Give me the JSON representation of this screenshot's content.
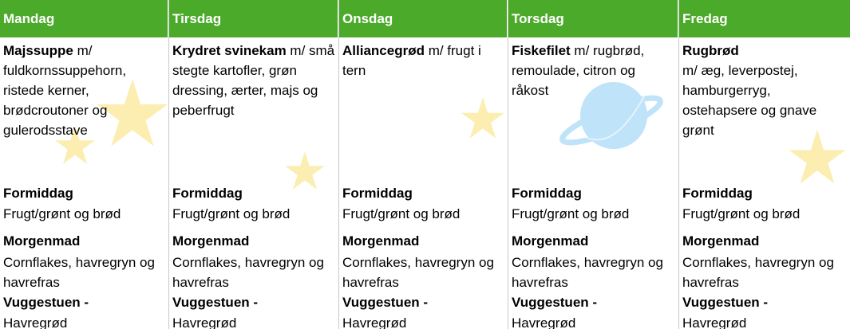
{
  "days": [
    {
      "name": "Mandag",
      "lunch_bold": "Majssuppe",
      "lunch_rest": " m/ fuldkornssuppehorn, ristede kerner, brødcroutoner og gulerodsstave",
      "morning_title": "Formiddag",
      "morning_text": "Frugt/grønt og brød",
      "breakfast_title": "Morgenmad",
      "breakfast_text": "Cornflakes, havregryn og havrefras",
      "nursery_title": "Vuggestuen -",
      "nursery_text": "Havregrød"
    },
    {
      "name": "Tirsdag",
      "lunch_bold": "Krydret svinekam",
      "lunch_rest": " m/ små stegte kartofler, grøn dressing, ærter, majs og peberfrugt",
      "morning_title": "Formiddag",
      "morning_text": "Frugt/grønt og brød",
      "breakfast_title": "Morgenmad",
      "breakfast_text": "Cornflakes, havregryn og havrefras",
      "nursery_title": "Vuggestuen -",
      "nursery_text": "Havregrød"
    },
    {
      "name": "Onsdag",
      "lunch_bold": "Alliancegrød",
      "lunch_rest": " m/ frugt i tern",
      "morning_title": "Formiddag",
      "morning_text": "Frugt/grønt og brød",
      "breakfast_title": "Morgenmad",
      "breakfast_text": "Cornflakes, havregryn og havrefras",
      "nursery_title": "Vuggestuen -",
      "nursery_text": "Havregrød"
    },
    {
      "name": "Torsdag",
      "lunch_bold": "Fiskefilet",
      "lunch_rest": " m/ rugbrød, remoulade, citron og råkost",
      "morning_title": "Formiddag",
      "morning_text": "Frugt/grønt og brød",
      "breakfast_title": "Morgenmad",
      "breakfast_text": "Cornflakes, havregryn og havrefras",
      "nursery_title": "Vuggestuen -",
      "nursery_text": "Havregrød"
    },
    {
      "name": "Fredag",
      "lunch_bold": "Rugbrød",
      "lunch_rest": " m/ æg, leverpostej, hamburgerryg, ostehapsere og gnave grønt",
      "morning_title": "Formiddag",
      "morning_text": "Frugt/grønt og brød",
      "breakfast_title": "Morgenmad",
      "breakfast_text": "Cornflakes, havregryn og havrefras",
      "nursery_title": "Vuggestuen -",
      "nursery_text": "Havregrød"
    }
  ],
  "colors": {
    "header_bg": "#4caa2a",
    "star": "#fbeeb0",
    "planet": "#bfe3f8"
  },
  "icons": [
    "star-icon",
    "planet-icon"
  ]
}
